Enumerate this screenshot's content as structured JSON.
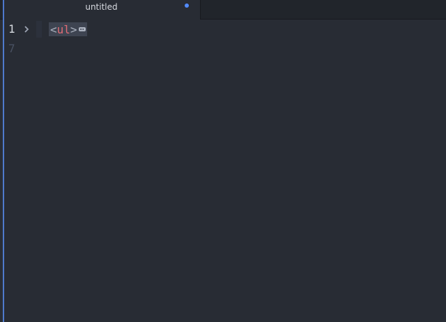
{
  "tab": {
    "title": "untitled",
    "modified": true
  },
  "gutter": {
    "lines": [
      "1",
      "7"
    ]
  },
  "code": {
    "open_bracket": "<",
    "tag_name": "ul",
    "close_bracket": ">"
  },
  "colors": {
    "background": "#282c34",
    "tab_bar": "#21252b",
    "accent": "#528bff",
    "tag_name": "#e06c75",
    "text": "#abb2bf"
  },
  "icons": {
    "fold": "chevron-right-icon",
    "folded_content": "ellipsis-icon",
    "modified": "modified-dot-icon"
  }
}
